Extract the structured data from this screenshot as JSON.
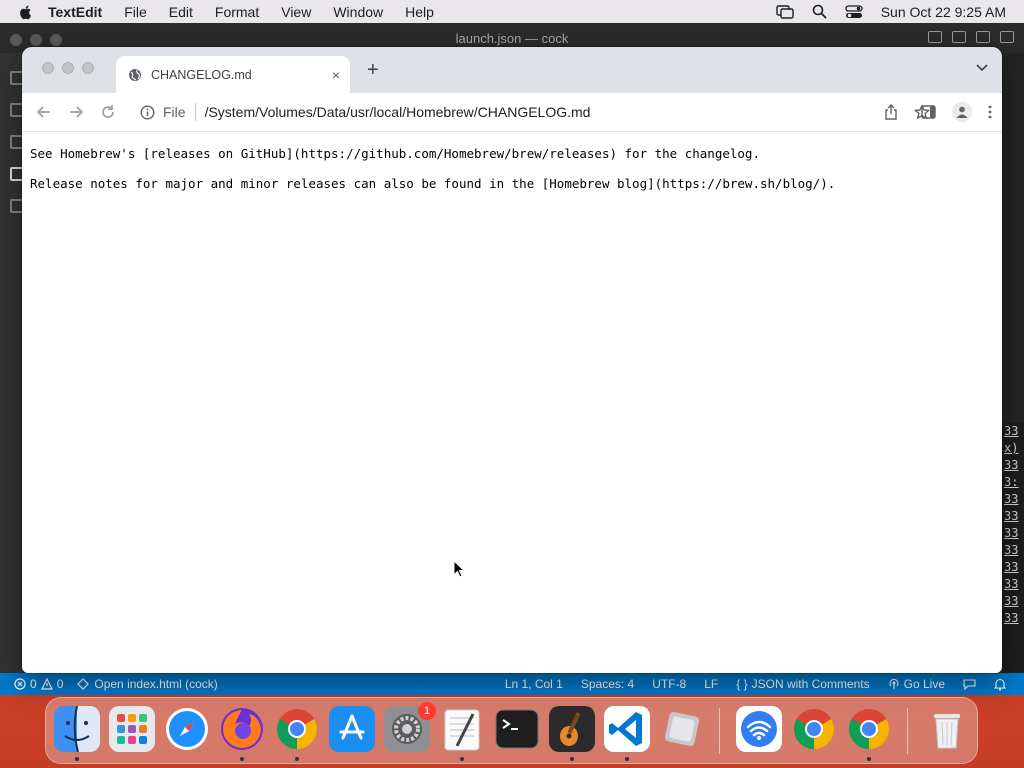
{
  "menubar": {
    "app_name": "TextEdit",
    "menus": [
      "File",
      "Edit",
      "Format",
      "View",
      "Window",
      "Help"
    ],
    "clock": "Sun Oct 22  9:25 AM"
  },
  "vscode": {
    "window_title": "launch.json — cock",
    "right_line_fragments": [
      "33",
      "x)",
      "33",
      "3:",
      "33",
      "33",
      "33",
      "33",
      "33",
      "33",
      "33",
      "33"
    ],
    "statusbar": {
      "errors": "0",
      "warnings": "0",
      "open_file": "Open index.html (cock)",
      "position": "Ln 1, Col 1",
      "spaces": "Spaces: 4",
      "encoding": "UTF-8",
      "eol": "LF",
      "language": "JSON with Comments",
      "go_live": "Go Live"
    }
  },
  "chrome": {
    "tab_title": "CHANGELOG.md",
    "new_tab_symbol": "+",
    "close_symbol": "×",
    "url_scheme": "File",
    "url_path": "/System/Volumes/Data/usr/local/Homebrew/CHANGELOG.md",
    "content_lines": [
      "See Homebrew's [releases on GitHub](https://github.com/Homebrew/brew/releases) for the changelog.",
      "Release notes for major and minor releases can also be found in the [Homebrew blog](https://brew.sh/blog/)."
    ]
  },
  "dock": {
    "settings_badge": "1",
    "apps": [
      "finder-icon",
      "launchpad-icon",
      "safari-icon",
      "firefox-icon",
      "chrome-icon",
      "app-store-icon",
      "system-settings-icon",
      "textedit-icon",
      "terminal-icon",
      "garageband-icon",
      "vscode-icon",
      "preview-icon",
      "wifi-settings-icon",
      "chrome-icon",
      "chrome-icon",
      "trash-icon"
    ]
  },
  "colors": {
    "statusbar": "#007acc",
    "chrome_tabstrip": "#dee1e6",
    "desktop": "#d9472a"
  }
}
